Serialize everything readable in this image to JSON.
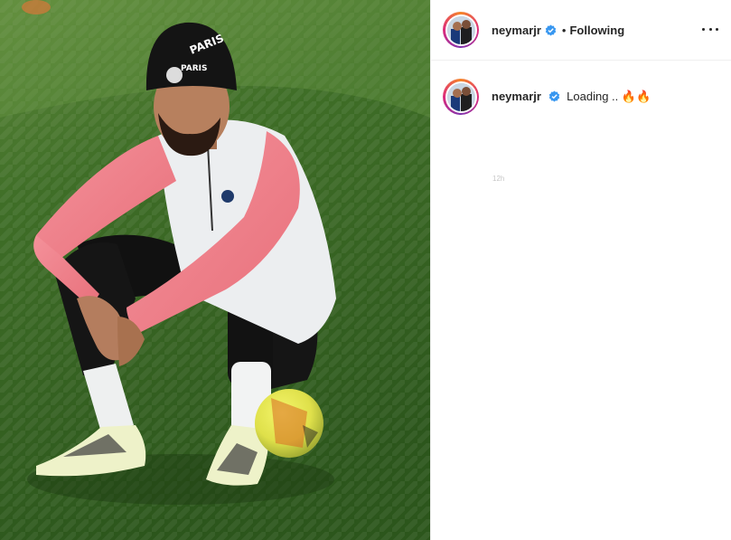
{
  "header": {
    "username": "neymarjr",
    "separator": "•",
    "follow_status": "Following",
    "more_icon": "more-horizontal-icon"
  },
  "caption": {
    "username": "neymarjr",
    "text": "Loading ..",
    "emoji": "🔥🔥",
    "timestamp": "12h"
  },
  "photo": {
    "beanie_text": "PARIS"
  },
  "colors": {
    "verified": "#3897f0",
    "text": "#262626",
    "divider": "#efefef"
  }
}
